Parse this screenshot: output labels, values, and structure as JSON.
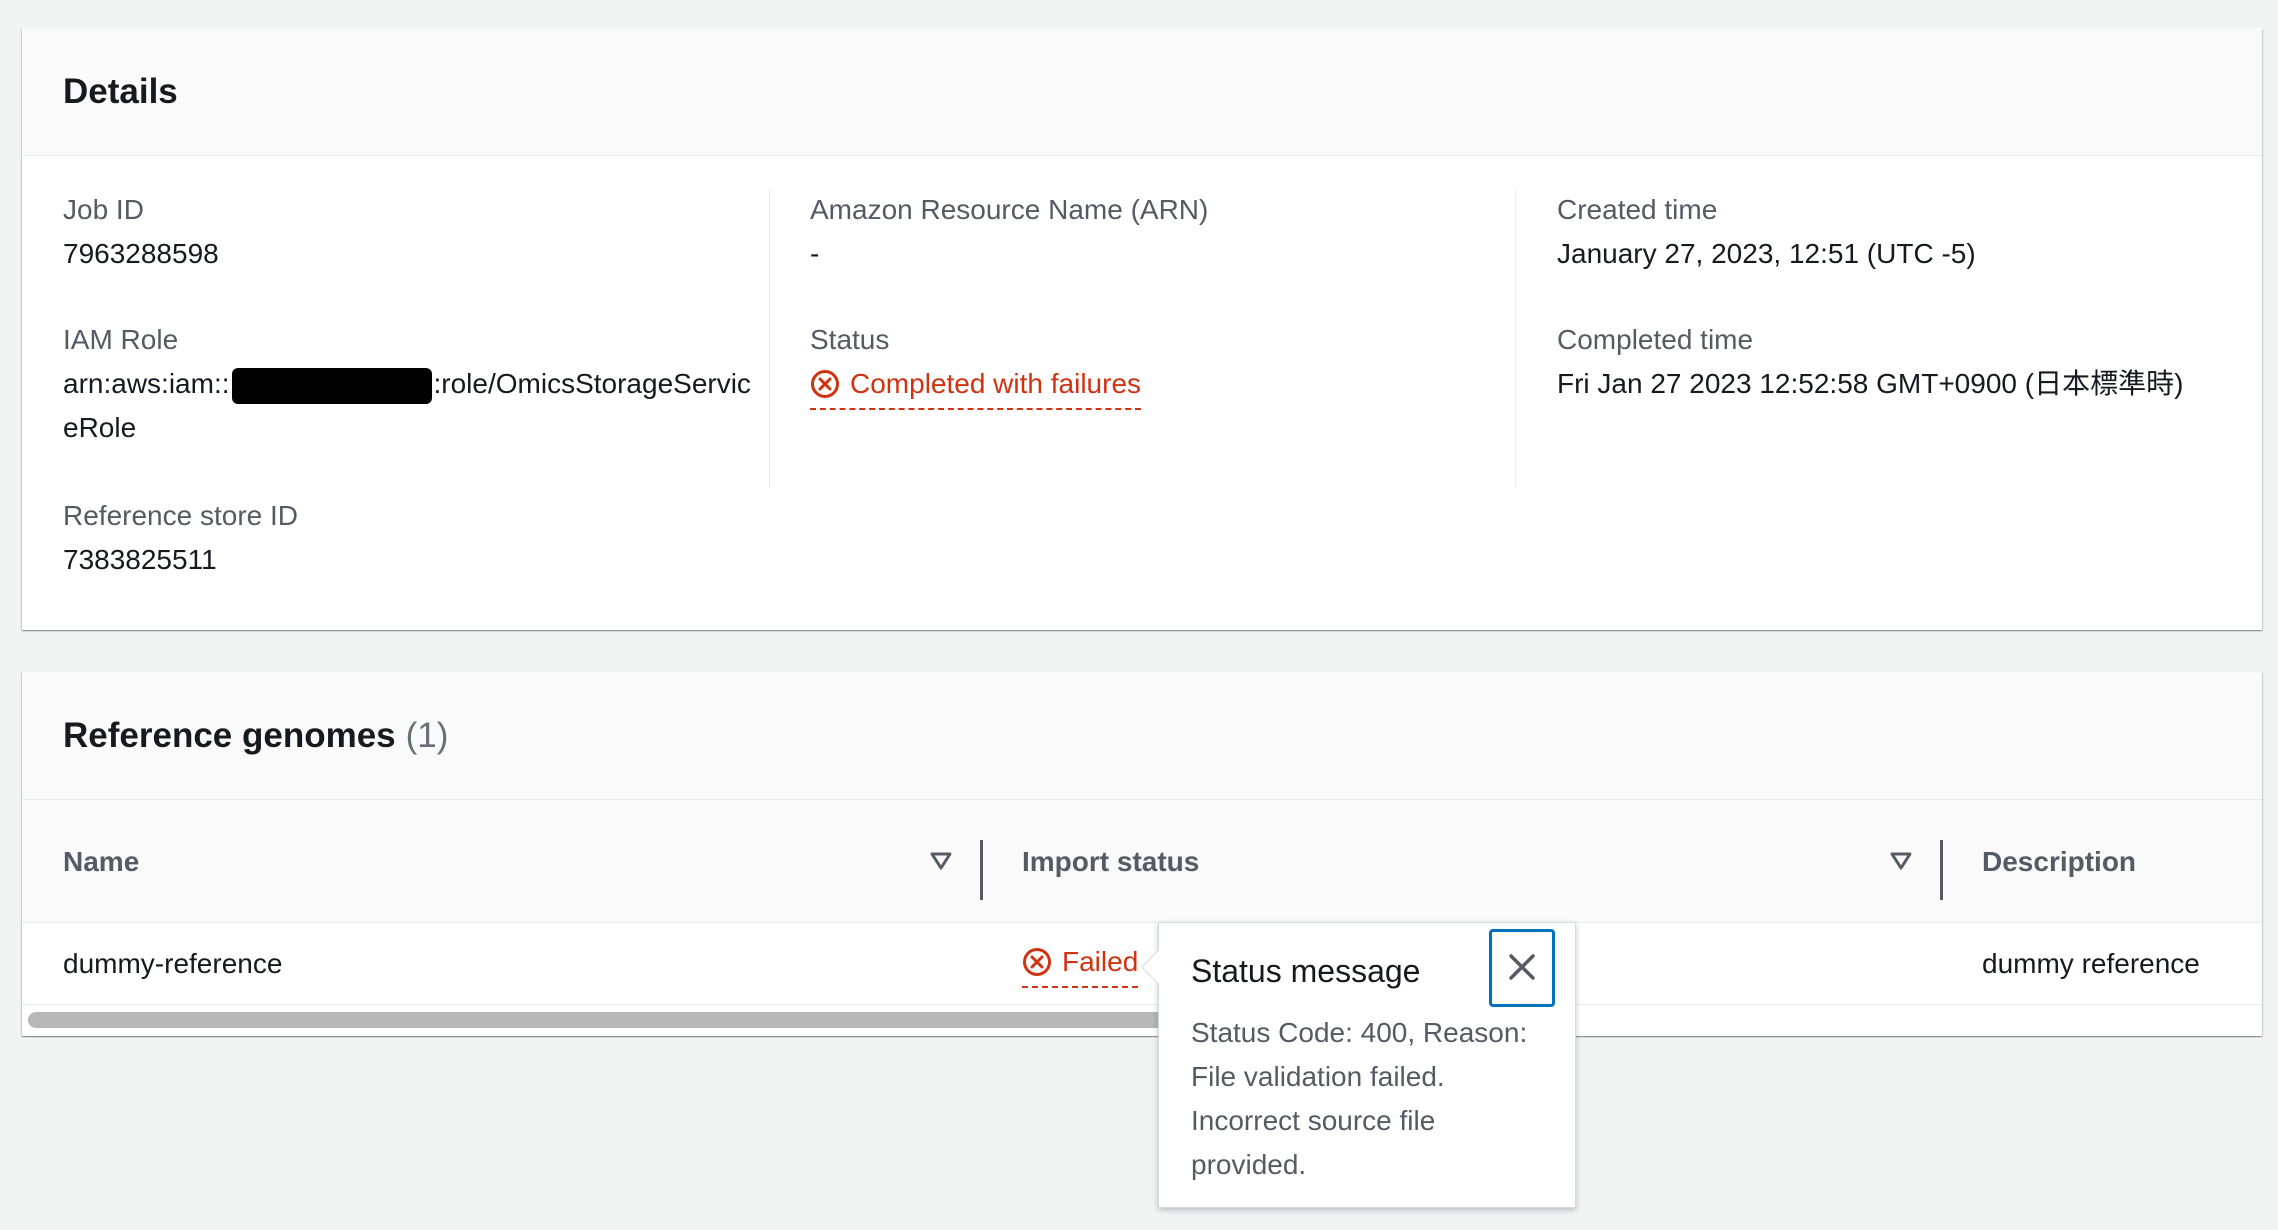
{
  "details": {
    "title": "Details",
    "job_id_label": "Job ID",
    "job_id_value": "7963288598",
    "iam_role_label": "IAM Role",
    "iam_role_prefix": "arn:aws:iam::",
    "iam_role_suffix": ":role/OmicsStorageServiceRole",
    "reference_store_label": "Reference store ID",
    "reference_store_value": "7383825511",
    "arn_label": "Amazon Resource Name (ARN)",
    "arn_value": "-",
    "status_label": "Status",
    "status_value": "Completed with failures",
    "created_label": "Created time",
    "created_value": "January 27, 2023, 12:51 (UTC -5)",
    "completed_label": "Completed time",
    "completed_value": "Fri Jan 27 2023 12:52:58 GMT+0900 (日本標準時)"
  },
  "reference_genomes": {
    "title": "Reference genomes",
    "count": "(1)",
    "columns": [
      "Name",
      "Import status",
      "Description"
    ],
    "rows": [
      {
        "name": "dummy-reference",
        "import_status": "Failed",
        "description": "dummy reference"
      }
    ]
  },
  "popover": {
    "title": "Status message",
    "body": "Status Code: 400, Reason: File validation failed. Incorrect source file provided."
  },
  "colors": {
    "error": "#d13212",
    "focus": "#0073bb"
  }
}
